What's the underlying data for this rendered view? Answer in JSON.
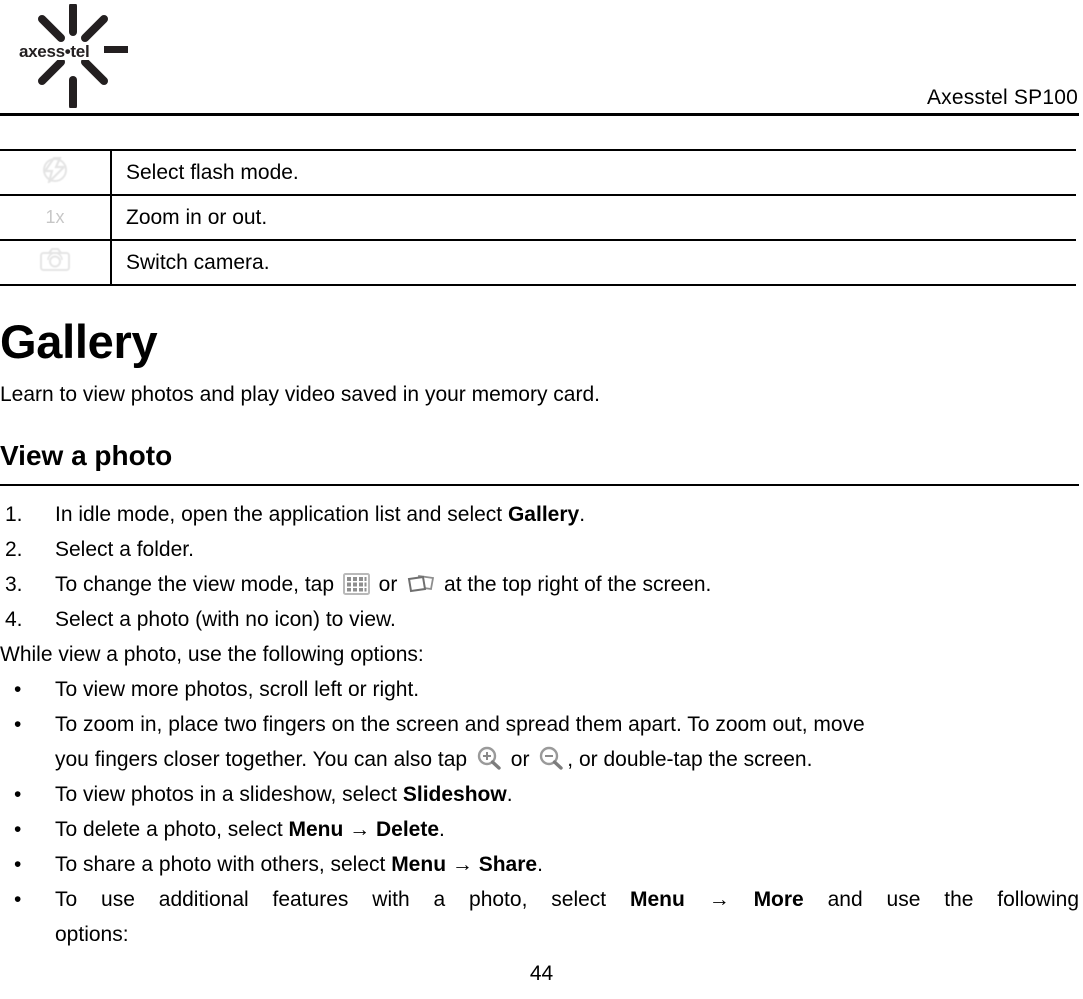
{
  "header": {
    "logo_text": "axess•tel",
    "logo_icon": "axesstel-starburst-logo",
    "title": "Axesstel SP100"
  },
  "options_table": {
    "rows": [
      {
        "icon": "flash-mode-icon",
        "icon_label": "",
        "description": "Select flash mode."
      },
      {
        "icon": "zoom-level-icon",
        "icon_label": "1x",
        "description": "Zoom in or out."
      },
      {
        "icon": "switch-camera-icon",
        "icon_label": "",
        "description": "Switch camera."
      }
    ]
  },
  "section": {
    "title": "Gallery",
    "intro": "Learn to view photos and play video saved in your memory card.",
    "subtitle": "View a photo"
  },
  "steps": [
    {
      "number": "1.",
      "parts": [
        {
          "text": "In idle mode, open the application list and select ",
          "bold": false
        },
        {
          "text": "Gallery",
          "bold": true
        },
        {
          "text": ".",
          "bold": false
        }
      ]
    },
    {
      "number": "2.",
      "parts": [
        {
          "text": "Select a folder.",
          "bold": false
        }
      ]
    },
    {
      "number": "3.",
      "parts": [
        {
          "text": "To change the view mode, tap ",
          "bold": false
        },
        {
          "icon": "grid-view-icon"
        },
        {
          "text": " or ",
          "bold": false
        },
        {
          "icon": "stack-view-icon"
        },
        {
          "text": " at the top right of the screen.",
          "bold": false
        }
      ]
    },
    {
      "number": "4.",
      "parts": [
        {
          "text": "Select a photo (with no icon) to view.",
          "bold": false
        }
      ]
    }
  ],
  "options_intro": "While view a photo, use the following options:",
  "bullets": [
    {
      "marker": "•",
      "lines": [
        [
          {
            "text": "To view more photos, scroll left or right.",
            "bold": false
          }
        ]
      ]
    },
    {
      "marker": "•",
      "lines": [
        [
          {
            "text": "To zoom in, place two fingers on the screen and spread them apart. To zoom out, move",
            "bold": false
          }
        ],
        [
          {
            "text": "you fingers closer together. You can also tap ",
            "bold": false
          },
          {
            "icon": "zoom-in-icon"
          },
          {
            "text": " or ",
            "bold": false
          },
          {
            "icon": "zoom-out-icon"
          },
          {
            "text": ", or double-tap the screen.",
            "bold": false
          }
        ]
      ]
    },
    {
      "marker": "•",
      "lines": [
        [
          {
            "text": "To view photos in a slideshow, select ",
            "bold": false
          },
          {
            "text": "Slideshow",
            "bold": true
          },
          {
            "text": ".",
            "bold": false
          }
        ]
      ]
    },
    {
      "marker": "•",
      "lines": [
        [
          {
            "text": "To delete a photo, select ",
            "bold": false
          },
          {
            "text": "Menu",
            "bold": true
          },
          {
            "text": "  →  ",
            "bold": true
          },
          {
            "text": "Delete",
            "bold": true
          },
          {
            "text": ".",
            "bold": false
          }
        ]
      ]
    },
    {
      "marker": "•",
      "lines": [
        [
          {
            "text": "To share a photo with others, select ",
            "bold": false
          },
          {
            "text": "Menu",
            "bold": true
          },
          {
            "text": "  →  ",
            "bold": true
          },
          {
            "text": "Share",
            "bold": true
          },
          {
            "text": ".",
            "bold": false
          }
        ]
      ]
    },
    {
      "marker": "•",
      "justify_first": true,
      "lines": [
        [
          {
            "text": "To use additional features with a photo, select ",
            "bold": false
          },
          {
            "text": "Menu",
            "bold": true
          },
          {
            "text": "  →  ",
            "bold": true
          },
          {
            "text": "More",
            "bold": true
          },
          {
            "text": " and use the following",
            "bold": false
          }
        ],
        [
          {
            "text": "options:",
            "bold": false
          }
        ]
      ]
    }
  ],
  "footer": {
    "page_number": "44"
  }
}
